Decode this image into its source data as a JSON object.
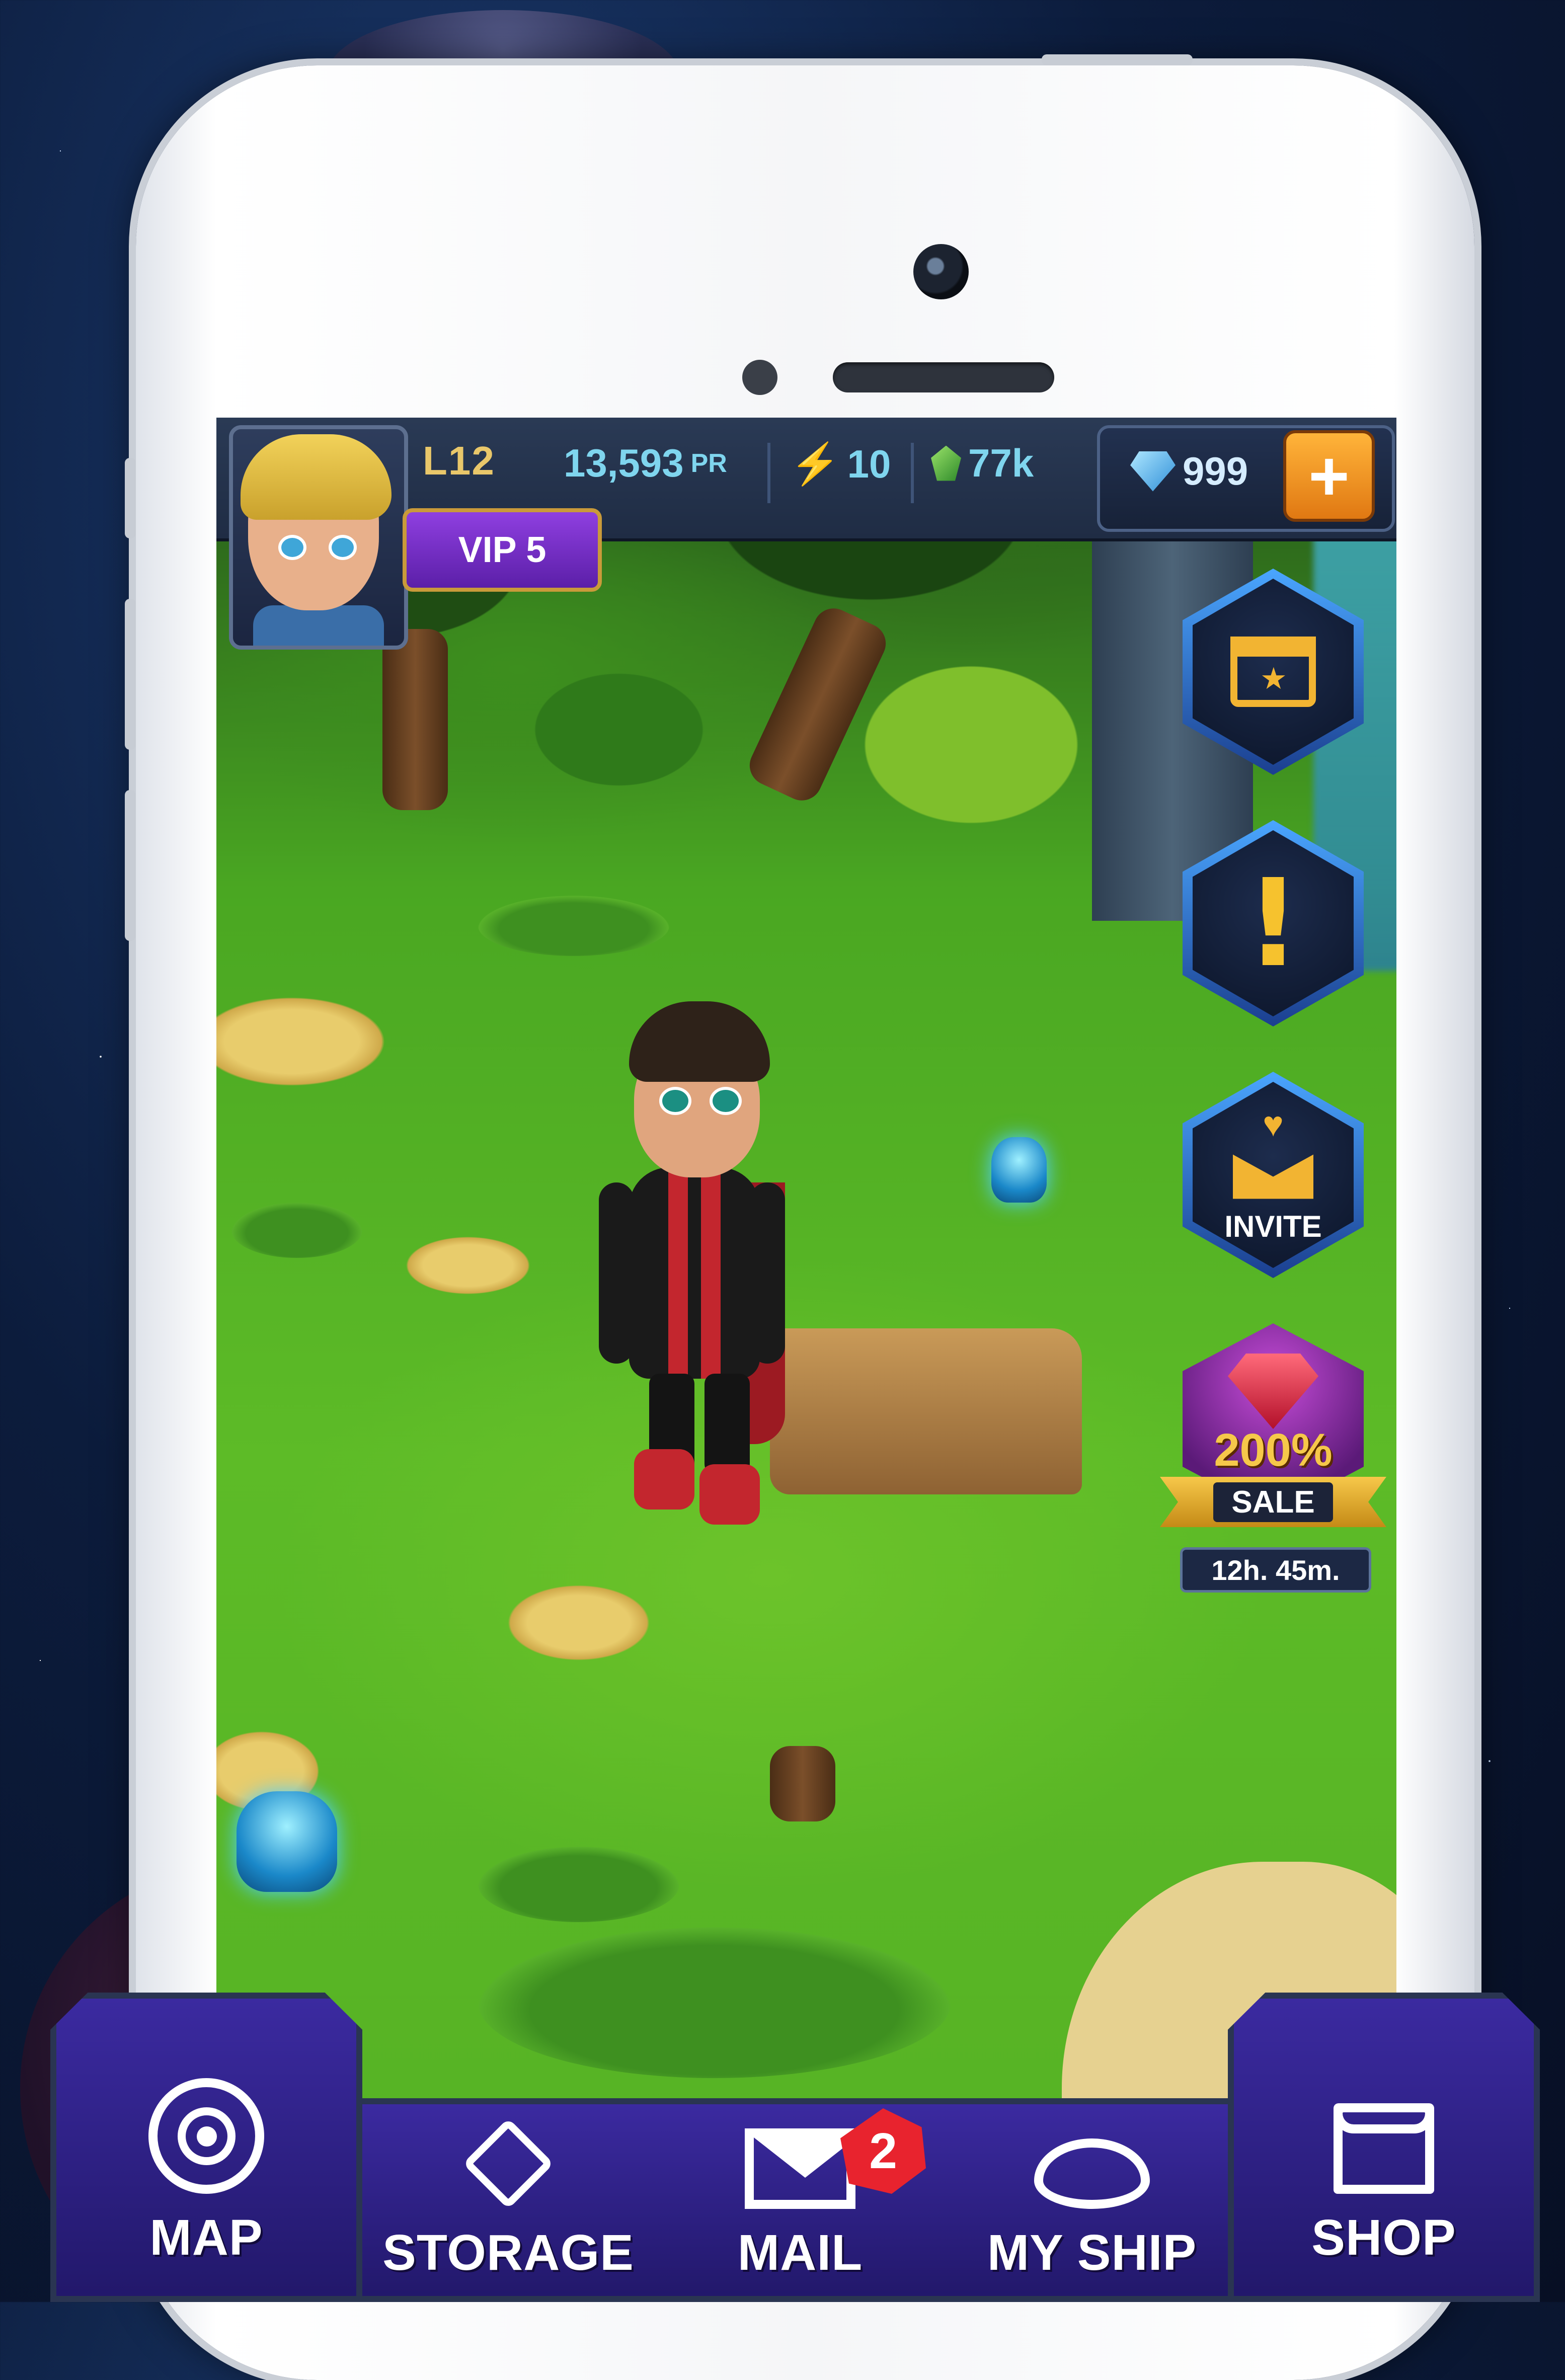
{
  "player": {
    "level": "L12",
    "vip": "VIP 5"
  },
  "resources": {
    "power": "13,593",
    "power_unit": "PR",
    "energy": "10",
    "emeralds": "77k",
    "gems": "999"
  },
  "side_buttons": {
    "events_icon": "calendar-star-icon",
    "alerts_icon": "exclamation-icon",
    "invite_label": "INVITE"
  },
  "sale": {
    "percent": "200%",
    "label": "SALE",
    "timer": "12h. 45m."
  },
  "nav": {
    "map": "MAP",
    "storage": "STORAGE",
    "mail": "MAIL",
    "mail_badge": "2",
    "my_ship": "MY SHIP",
    "shop": "SHOP"
  },
  "colors": {
    "hud_text": "#7fd5ee",
    "level_gold": "#e9c76a",
    "vip_purple": "#8f3fe0",
    "nav_purple": "#3b2aa0",
    "badge_red": "#e8232e"
  }
}
